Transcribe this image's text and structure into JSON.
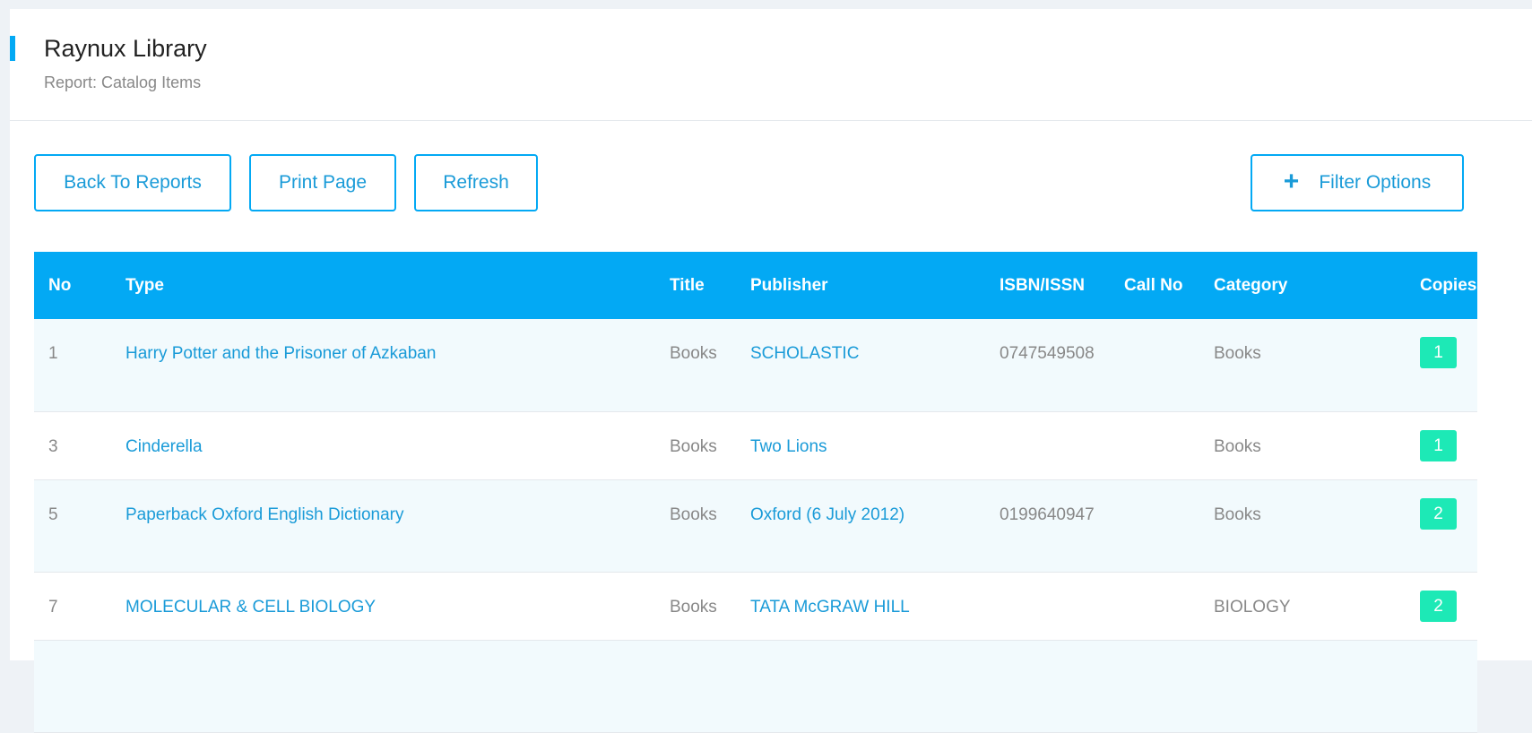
{
  "header": {
    "title": "Raynux Library",
    "subtitle": "Report: Catalog Items"
  },
  "toolbar": {
    "back_label": "Back To Reports",
    "print_label": "Print Page",
    "refresh_label": "Refresh",
    "filter_icon": "plus-icon",
    "filter_icon_glyph": "+",
    "filter_label": "Filter Options"
  },
  "colors": {
    "accent": "#03a9f4",
    "badge": "#1de9b6",
    "link": "#1a9bd8"
  },
  "table": {
    "columns": [
      "No",
      "Type",
      "Title",
      "Publisher",
      "ISBN/ISSN",
      "Call No",
      "Category",
      "Copies"
    ],
    "rows": [
      {
        "no": "1",
        "type": "Harry Potter and the Prisoner of Azkaban",
        "title": "Books",
        "publisher": "SCHOLASTIC",
        "isbn": "0747549508",
        "call_no": "",
        "category": "Books",
        "copies": "1"
      },
      {
        "no": "3",
        "type": "Cinderella",
        "title": "Books",
        "publisher": "Two Lions",
        "isbn": "",
        "call_no": "",
        "category": "Books",
        "copies": "1"
      },
      {
        "no": "5",
        "type": "Paperback Oxford English Dictionary",
        "title": "Books",
        "publisher": "Oxford (6 July 2012)",
        "isbn": "0199640947",
        "call_no": "",
        "category": "Books",
        "copies": "2"
      },
      {
        "no": "7",
        "type": "MOLECULAR & CELL BIOLOGY",
        "title": "Books",
        "publisher": "TATA McGRAW HILL",
        "isbn": "",
        "call_no": "",
        "category": "BIOLOGY",
        "copies": "2"
      }
    ]
  }
}
